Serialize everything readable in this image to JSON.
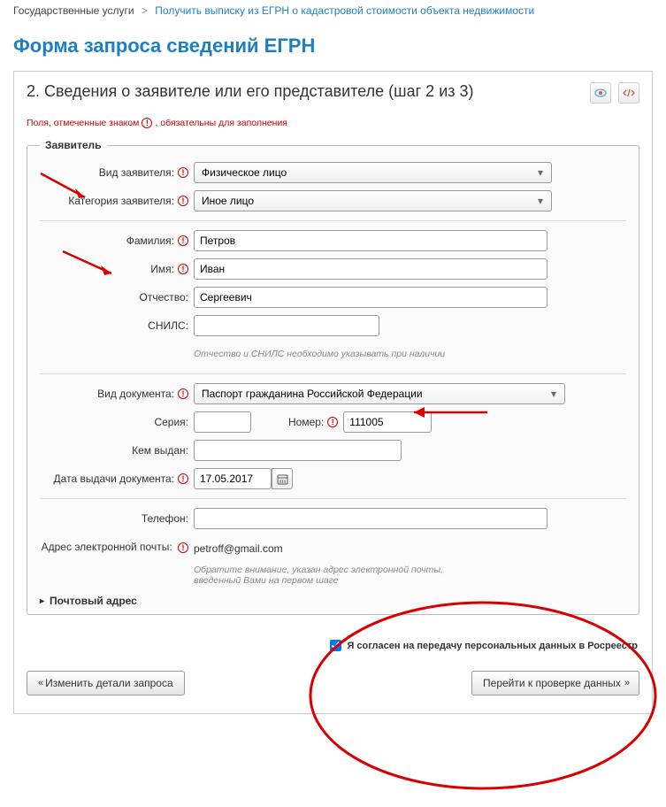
{
  "breadcrumb": {
    "root": "Государственные услуги",
    "current": "Получить выписку из ЕГРН о кадастровой стоимости объекта недвижимости"
  },
  "page_title": "Форма запроса сведений ЕГРН",
  "step_title": "2. Сведения о заявителе или его представителе (шаг 2 из 3)",
  "required_note": {
    "prefix": "Поля, отмеченные знаком",
    "suffix": "обязательны для заполнения"
  },
  "fieldset": {
    "legend": "Заявитель",
    "applicant_type": {
      "label": "Вид заявителя:",
      "value": "Физическое лицо"
    },
    "applicant_category": {
      "label": "Категория заявителя:",
      "value": "Иное лицо"
    },
    "surname": {
      "label": "Фамилия:",
      "value": "Петров"
    },
    "name": {
      "label": "Имя:",
      "value": "Иван"
    },
    "patronymic": {
      "label": "Отчество:",
      "value": "Сергеевич"
    },
    "snils": {
      "label": "СНИЛС:",
      "value": ""
    },
    "patronymic_hint": "Отчество и СНИЛС необходимо указывать при наличии",
    "doc_type": {
      "label": "Вид документа:",
      "value": "Паспорт гражданина Российской Федерации"
    },
    "series": {
      "label": "Серия:",
      "value": ""
    },
    "number": {
      "label": "Номер:",
      "value": "111005"
    },
    "issued_by": {
      "label": "Кем выдан:",
      "value": ""
    },
    "issue_date": {
      "label": "Дата выдачи документа:",
      "value": "17.05.2017"
    },
    "phone": {
      "label": "Телефон:",
      "value": ""
    },
    "email": {
      "label": "Адрес электронной почты:",
      "value": "petroff@gmail.com"
    },
    "email_hint": "Обратите внимание, указан адрес электронной почты, введенный Вами на первом шаге",
    "postal_address": "Почтовый адрес"
  },
  "consent": {
    "label": "Я согласен на передачу персональных данных в Росреестр",
    "checked": true
  },
  "buttons": {
    "back": "Изменить детали запроса",
    "next": "Перейти к проверке данных"
  }
}
